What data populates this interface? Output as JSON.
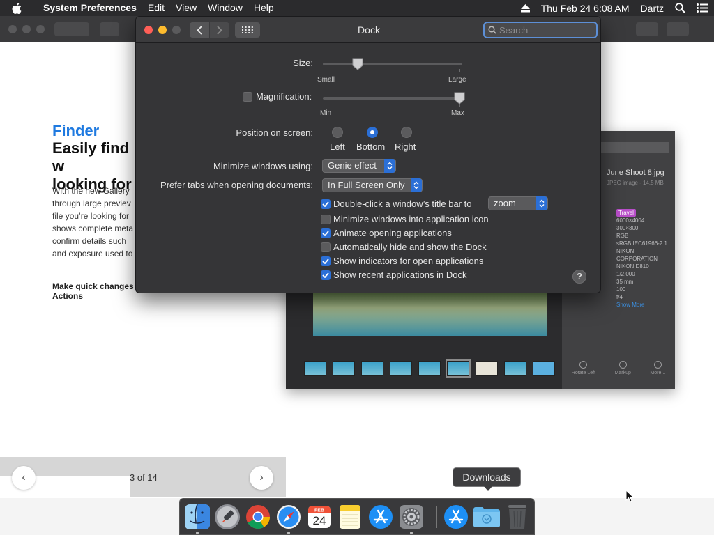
{
  "menubar": {
    "app_name": "System Preferences",
    "menus": [
      "Edit",
      "View",
      "Window",
      "Help"
    ],
    "datetime": "Thu Feb 24  6:08 AM",
    "user": "Dartz"
  },
  "background_page": {
    "finder_title": "Finder",
    "headline_line1": "Easily find w",
    "headline_line2": "looking for",
    "body_lines": [
      "With the new Gallery",
      "through large previev",
      "file you’re looking for",
      "shows complete meta",
      "confirm details such",
      "and exposure used to"
    ],
    "subhead_line1": "Make quick changes",
    "subhead_line2": "Actions",
    "pager_count": "3 of 14",
    "prev_glyph": "‹",
    "next_glyph": "›"
  },
  "photos_window": {
    "file_name": "June Shoot 8.jpg",
    "file_sub": "JPEG image - 14.5 MB",
    "tag": "Travel",
    "meta_lines": [
      "6000×4004",
      "300×300",
      "RGB",
      "sRGB IEC61966-2.1",
      "NIKON",
      "CORPORATION",
      "NIKON D810",
      "1/2,000",
      "35 mm",
      "100",
      "f/4"
    ],
    "show_more": "Show More",
    "tools": [
      "Rotate Left",
      "Markup",
      "More..."
    ]
  },
  "prefs": {
    "window_title": "Dock",
    "search_placeholder": "Search",
    "size_label": "Size:",
    "size_small": "Small",
    "size_large": "Large",
    "size_value": 0.24,
    "magnification_label": "Magnification:",
    "magnification_checked": false,
    "mag_min": "Min",
    "mag_max": "Max",
    "mag_value": 1.0,
    "position_label": "Position on screen:",
    "positions": [
      "Left",
      "Bottom",
      "Right"
    ],
    "position_selected": "Bottom",
    "minimize_label": "Minimize windows using:",
    "minimize_value": "Genie effect",
    "tabs_label": "Prefer tabs when opening documents:",
    "tabs_value": "In Full Screen Only",
    "dblclick_label": "Double-click a window’s title bar to",
    "dblclick_value": "zoom",
    "checkboxes": [
      {
        "label": "Double-click a window’s title bar to",
        "checked": true
      },
      {
        "label": "Minimize windows into application icon",
        "checked": false
      },
      {
        "label": "Animate opening applications",
        "checked": true
      },
      {
        "label": "Automatically hide and show the Dock",
        "checked": false
      },
      {
        "label": "Show indicators for open applications",
        "checked": true
      },
      {
        "label": "Show recent applications in Dock",
        "checked": true
      }
    ],
    "help_glyph": "?"
  },
  "dock": {
    "tooltip": "Downloads",
    "calendar_month": "FEB",
    "calendar_day": "24",
    "apps": [
      "Finder",
      "Launchpad",
      "Google Chrome",
      "Safari",
      "Calendar",
      "Notes",
      "App Store",
      "System Preferences",
      "Applications",
      "Downloads",
      "Trash"
    ]
  },
  "colors": {
    "accent": "#2b6fd6",
    "finder_blue": "#1f7ae0",
    "close": "#ff5f57",
    "minimize": "#febc2e",
    "zoom_disabled": "#5a5a5c"
  }
}
